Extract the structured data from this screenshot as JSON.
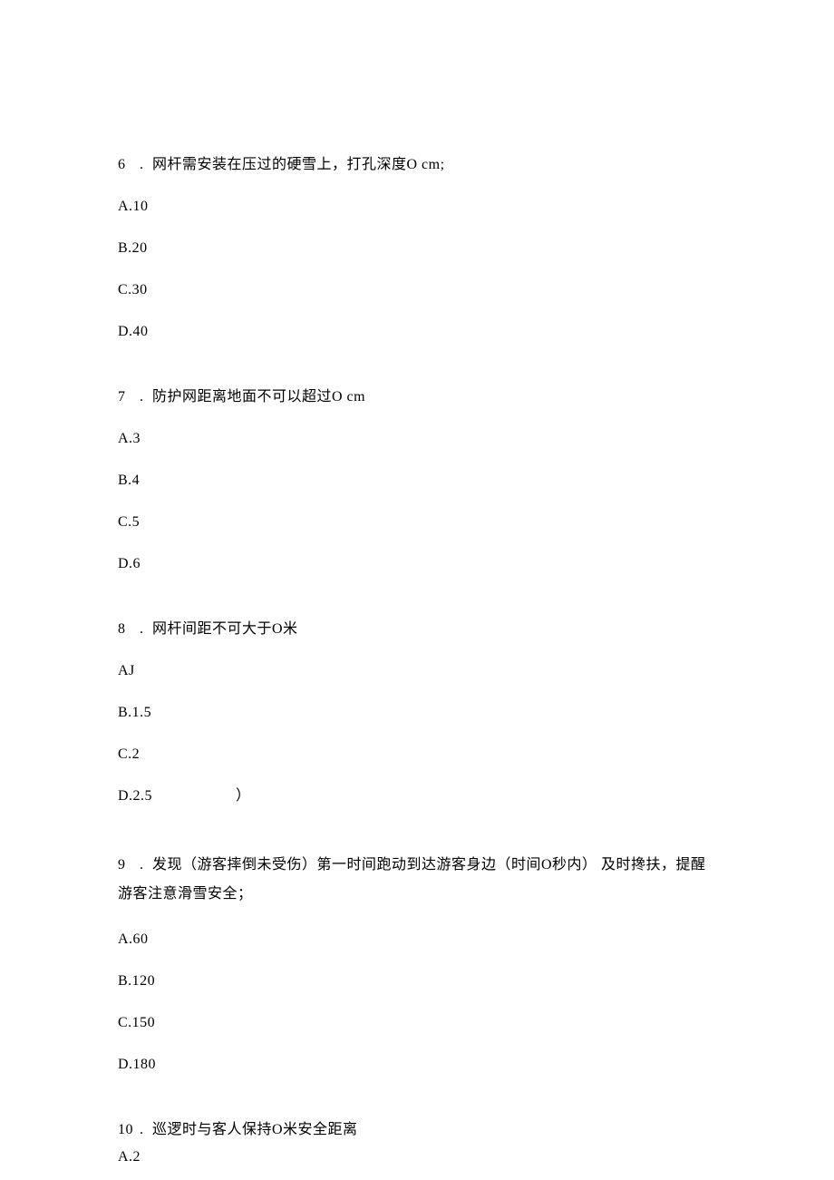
{
  "questions": [
    {
      "num": "6",
      "sep": ". ",
      "text": "网杆需安装在压过的硬雪上，打孔深度O cm;",
      "options": [
        "A.10",
        "B.20",
        "C.30",
        "D.40"
      ]
    },
    {
      "num": "7",
      "sep": ".",
      "text": "防护网距离地面不可以超过O cm",
      "options": [
        "A.3",
        "B.4",
        "C.5",
        "D.6"
      ]
    },
    {
      "num": "8",
      "sep": ". ",
      "text": "网杆间距不可大于O米",
      "options": [
        "AJ",
        "B.1.5",
        "C.2",
        "D.2.5"
      ],
      "paren": "）"
    },
    {
      "num": "9",
      "sep": ". ",
      "text": "发现（游客摔倒未受伤）第一时间跑动到达游客身边（时间O秒内） 及时搀扶，提醒游客注意滑雪安全；",
      "options": [
        "A.60",
        "B.120",
        "C.150",
        "D.180"
      ]
    },
    {
      "num": "10",
      "sep": ".",
      "text": "巡逻时与客人保持O米安全距离",
      "options": [
        "A.2"
      ]
    }
  ]
}
